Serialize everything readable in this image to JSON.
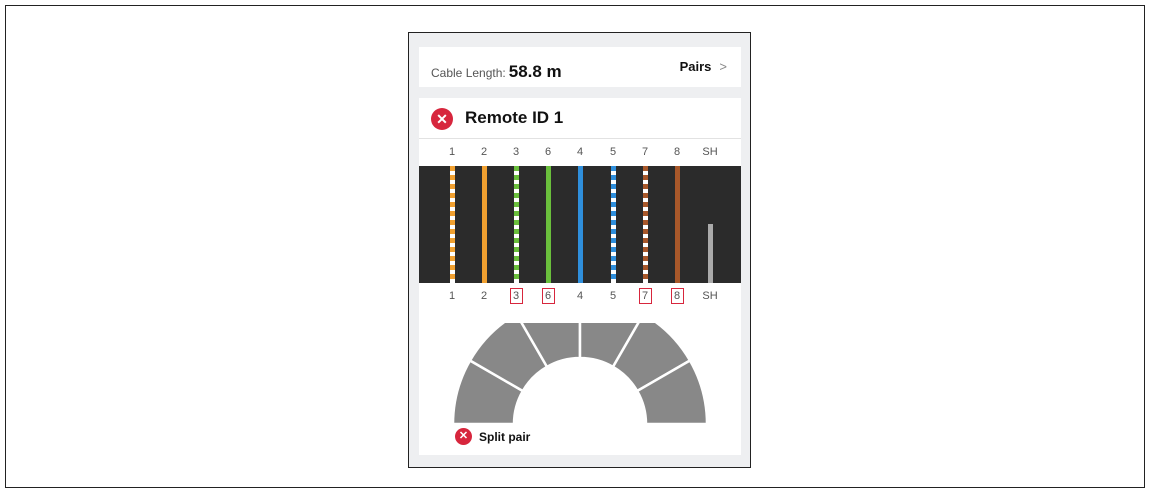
{
  "cable": {
    "length_label": "Cable Length:",
    "length_value": "58.8 m",
    "pairs_label": "Pairs",
    "chevron": ">"
  },
  "remote": {
    "status_icon": "error-x-icon",
    "status_glyph": "✕",
    "title": "Remote ID 1"
  },
  "top_pins": [
    "1",
    "2",
    "3",
    "6",
    "4",
    "5",
    "7",
    "8",
    "SH"
  ],
  "bottom_pins": [
    {
      "label": "1",
      "fault": false
    },
    {
      "label": "2",
      "fault": false
    },
    {
      "label": "3",
      "fault": true
    },
    {
      "label": "6",
      "fault": true
    },
    {
      "label": "4",
      "fault": false
    },
    {
      "label": "5",
      "fault": false
    },
    {
      "label": "7",
      "fault": true
    },
    {
      "label": "8",
      "fault": true
    },
    {
      "label": "SH",
      "fault": false
    }
  ],
  "wires": [
    {
      "pin": "1",
      "color": "#f0a030",
      "striped": true,
      "level": 1.0
    },
    {
      "pin": "2",
      "color": "#f0a030",
      "striped": false,
      "level": 1.0
    },
    {
      "pin": "3",
      "color": "#6abf3c",
      "striped": true,
      "level": 1.0
    },
    {
      "pin": "6",
      "color": "#6abf3c",
      "striped": false,
      "level": 1.0
    },
    {
      "pin": "4",
      "color": "#2f8fdc",
      "striped": false,
      "level": 1.0
    },
    {
      "pin": "5",
      "color": "#2f8fdc",
      "striped": true,
      "level": 1.0
    },
    {
      "pin": "7",
      "color": "#a8582a",
      "striped": true,
      "level": 1.0
    },
    {
      "pin": "8",
      "color": "#a8582a",
      "striped": false,
      "level": 1.0
    },
    {
      "pin": "SH",
      "color": "#aaaaaa",
      "striped": false,
      "level": 0.5
    }
  ],
  "colors": {
    "error": "#d7263d",
    "arc_segment": "#888888",
    "wire_band": "#2b2b2b"
  },
  "diagnosis": {
    "status_icon": "error-x-icon",
    "status_glyph": "✕",
    "label": "Split pair"
  }
}
